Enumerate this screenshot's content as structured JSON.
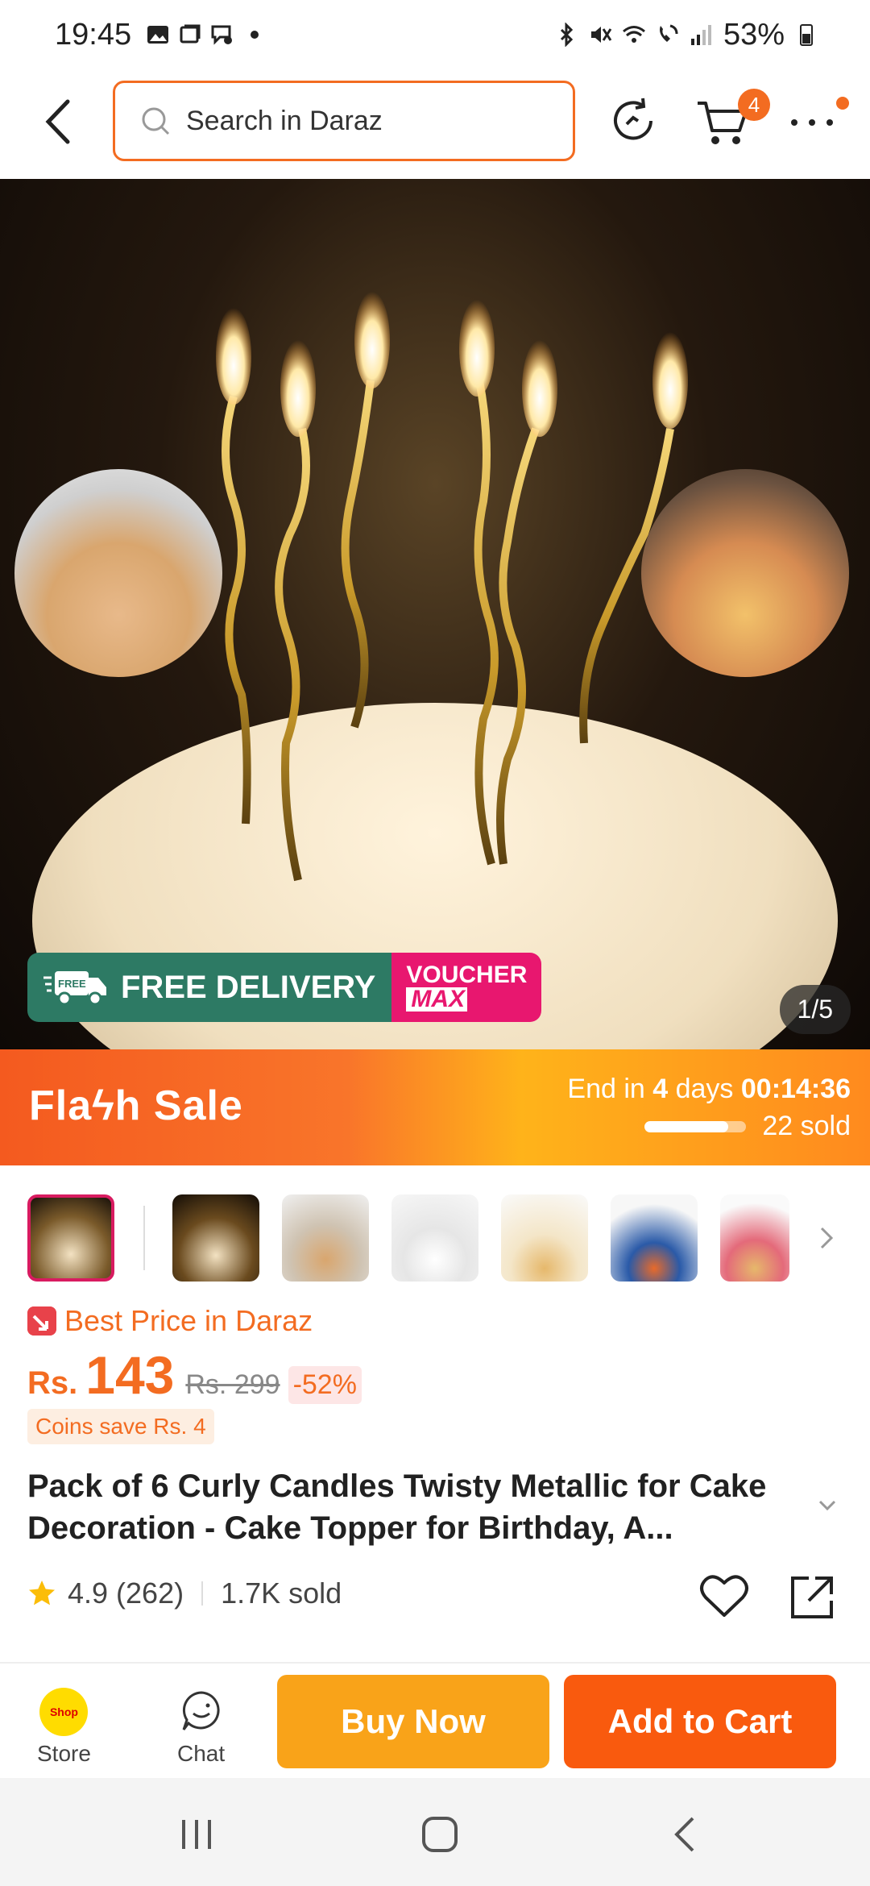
{
  "status_bar": {
    "time": "19:45",
    "battery": "53%"
  },
  "header": {
    "search_placeholder": "Search in Daraz",
    "cart_count": "4"
  },
  "hero": {
    "free_delivery": "FREE DELIVERY",
    "free_tag": "FREE",
    "voucher_line1": "VOUCHER",
    "voucher_line2": "MAX",
    "image_counter": "1/5"
  },
  "flash_sale": {
    "title": "Flaϟh Sale",
    "end_prefix": "End in ",
    "days_num": "4",
    "days_label": " days ",
    "countdown": "00:14:36",
    "sold": "22 sold",
    "progress_fraction": 0.82
  },
  "product": {
    "best_price": "Best Price in Daraz",
    "currency": "Rs.",
    "price": "143",
    "old_price": "Rs. 299",
    "discount": "-52%",
    "coins": "Coins save Rs. 4",
    "title": "Pack of 6 Curly Candles Twisty Metallic for Cake Decoration - Cake Topper for Birthday, A...",
    "rating": "4.9",
    "reviews": "(262)",
    "sold": "1.7K sold"
  },
  "bottom_bar": {
    "store_label": "Store",
    "store_logo_text": "Shop",
    "chat_label": "Chat",
    "buy_now": "Buy Now",
    "add_to_cart": "Add to Cart"
  },
  "colors": {
    "accent": "#f36c21",
    "buy_now": "#f9a319",
    "add_to_cart": "#f95a0e",
    "free_delivery": "#2d7a64",
    "voucher": "#e8176f"
  }
}
